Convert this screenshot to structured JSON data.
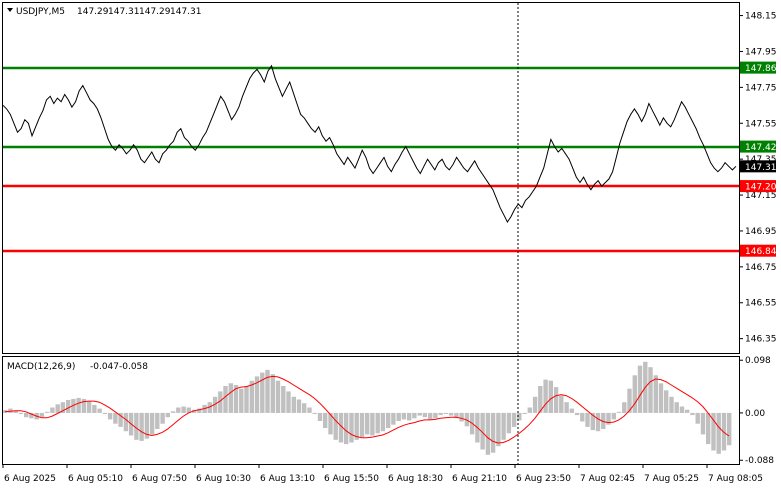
{
  "chart_data": [
    {
      "type": "line",
      "title": "USDJPY,M5",
      "ohlc": [
        "147.29",
        "147.31",
        "147.29",
        "147.31"
      ],
      "ylim": [
        146.27,
        148.22
      ],
      "yticks": [
        "148.15",
        "147.95",
        "147.75",
        "147.55",
        "147.35",
        "147.15",
        "146.95",
        "146.75",
        "146.55",
        "146.35"
      ],
      "ytick_values": [
        148.15,
        147.95,
        147.75,
        147.55,
        147.35,
        147.15,
        146.95,
        146.75,
        146.55,
        146.35
      ],
      "xticks": [
        "6 Aug 2025",
        "6 Aug 05:10",
        "6 Aug 07:50",
        "6 Aug 10:30",
        "6 Aug 13:10",
        "6 Aug 15:50",
        "6 Aug 18:30",
        "6 Aug 21:10",
        "6 Aug 23:50",
        "7 Aug 02:45",
        "7 Aug 05:25",
        "7 Aug 08:05"
      ],
      "current_price": 147.31,
      "current_label": "147.31",
      "levels": [
        {
          "label": "147.86",
          "value": 147.86,
          "color": "#008000"
        },
        {
          "label": "147.42",
          "value": 147.42,
          "color": "#008000"
        },
        {
          "label": "147.20",
          "value": 147.2,
          "color": "#ff0000"
        },
        {
          "label": "146.84",
          "value": 146.84,
          "color": "#ff0000"
        }
      ],
      "price": [
        147.65,
        147.63,
        147.6,
        147.55,
        147.5,
        147.52,
        147.57,
        147.55,
        147.48,
        147.53,
        147.58,
        147.62,
        147.68,
        147.7,
        147.66,
        147.69,
        147.67,
        147.71,
        147.68,
        147.64,
        147.67,
        147.73,
        147.76,
        147.72,
        147.68,
        147.66,
        147.63,
        147.58,
        147.52,
        147.46,
        147.42,
        147.4,
        147.43,
        147.41,
        147.38,
        147.4,
        147.43,
        147.4,
        147.35,
        147.33,
        147.36,
        147.39,
        147.35,
        147.33,
        147.38,
        147.4,
        147.43,
        147.45,
        147.5,
        147.52,
        147.47,
        147.45,
        147.42,
        147.4,
        147.43,
        147.47,
        147.5,
        147.55,
        147.6,
        147.65,
        147.7,
        147.67,
        147.62,
        147.57,
        147.6,
        147.64,
        147.7,
        147.75,
        147.8,
        147.83,
        147.85,
        147.82,
        147.78,
        147.84,
        147.87,
        147.8,
        147.75,
        147.7,
        147.74,
        147.78,
        147.72,
        147.66,
        147.6,
        147.58,
        147.55,
        147.52,
        147.5,
        147.53,
        147.48,
        147.45,
        147.47,
        147.43,
        147.38,
        147.35,
        147.32,
        147.36,
        147.33,
        147.3,
        147.35,
        147.4,
        147.36,
        147.3,
        147.27,
        147.3,
        147.33,
        147.36,
        147.31,
        147.28,
        147.32,
        147.35,
        147.39,
        147.42,
        147.38,
        147.34,
        147.3,
        147.27,
        147.31,
        147.35,
        147.32,
        147.29,
        147.33,
        147.35,
        147.31,
        147.29,
        147.32,
        147.36,
        147.33,
        147.3,
        147.28,
        147.31,
        147.34,
        147.3,
        147.27,
        147.24,
        147.21,
        147.18,
        147.13,
        147.08,
        147.04,
        147.0,
        147.03,
        147.07,
        147.1,
        147.08,
        147.12,
        147.14,
        147.17,
        147.2,
        147.25,
        147.3,
        147.38,
        147.46,
        147.42,
        147.39,
        147.41,
        147.38,
        147.35,
        147.3,
        147.25,
        147.22,
        147.25,
        147.21,
        147.18,
        147.21,
        147.23,
        147.2,
        147.22,
        147.24,
        147.28,
        147.36,
        147.44,
        147.5,
        147.56,
        147.6,
        147.63,
        147.6,
        147.56,
        147.6,
        147.66,
        147.62,
        147.58,
        147.54,
        147.58,
        147.55,
        147.53,
        147.57,
        147.62,
        147.67,
        147.64,
        147.6,
        147.56,
        147.52,
        147.47,
        147.43,
        147.38,
        147.33,
        147.3,
        147.28,
        147.3,
        147.33,
        147.31,
        147.29,
        147.31
      ]
    },
    {
      "type": "bar",
      "title": "MACD(12,26,9)",
      "values_label": [
        "-0.047",
        "-0.058"
      ],
      "ylim": [
        -0.095,
        0.104
      ],
      "yticks": [
        "0.098",
        "0.00",
        "-0.088"
      ],
      "ytick_values": [
        0.098,
        0.0,
        -0.088
      ],
      "histogram": [
        0.005,
        0.008,
        0.004,
        -0.002,
        -0.008,
        -0.01,
        -0.012,
        -0.008,
        0.002,
        0.01,
        0.016,
        0.02,
        0.024,
        0.026,
        0.028,
        0.026,
        0.022,
        0.015,
        0.008,
        -0.002,
        -0.012,
        -0.02,
        -0.026,
        -0.034,
        -0.042,
        -0.05,
        -0.052,
        -0.048,
        -0.04,
        -0.03,
        -0.02,
        -0.008,
        0.003,
        0.01,
        0.012,
        0.01,
        0.006,
        0.008,
        0.015,
        0.02,
        0.03,
        0.04,
        0.05,
        0.055,
        0.052,
        0.045,
        0.05,
        0.06,
        0.068,
        0.075,
        0.08,
        0.072,
        0.06,
        0.05,
        0.04,
        0.03,
        0.025,
        0.018,
        0.01,
        -0.002,
        -0.015,
        -0.028,
        -0.04,
        -0.05,
        -0.055,
        -0.058,
        -0.055,
        -0.05,
        -0.045,
        -0.04,
        -0.042,
        -0.038,
        -0.034,
        -0.028,
        -0.022,
        -0.015,
        -0.012,
        -0.014,
        -0.01,
        -0.005,
        -0.008,
        -0.012,
        -0.01,
        -0.004,
        -0.002,
        -0.005,
        -0.01,
        -0.016,
        -0.025,
        -0.04,
        -0.055,
        -0.068,
        -0.078,
        -0.074,
        -0.062,
        -0.05,
        -0.038,
        -0.026,
        -0.014,
        -0.002,
        0.01,
        0.03,
        0.05,
        0.062,
        0.06,
        0.048,
        0.032,
        0.02,
        0.008,
        -0.004,
        -0.016,
        -0.026,
        -0.032,
        -0.034,
        -0.03,
        -0.022,
        -0.012,
        0.002,
        0.02,
        0.045,
        0.07,
        0.088,
        0.095,
        0.085,
        0.07,
        0.055,
        0.042,
        0.03,
        0.02,
        0.012,
        0.006,
        -0.004,
        -0.02,
        -0.04,
        -0.058,
        -0.07,
        -0.076,
        -0.07,
        -0.06
      ],
      "signal": [
        0.002,
        0.003,
        0.004,
        0.004,
        0.002,
        -0.002,
        -0.006,
        -0.009,
        -0.009,
        -0.006,
        -0.001,
        0.004,
        0.009,
        0.014,
        0.018,
        0.021,
        0.022,
        0.022,
        0.02,
        0.015,
        0.009,
        0.002,
        -0.005,
        -0.012,
        -0.02,
        -0.028,
        -0.035,
        -0.04,
        -0.042,
        -0.04,
        -0.036,
        -0.03,
        -0.022,
        -0.014,
        -0.006,
        0.0,
        0.004,
        0.006,
        0.008,
        0.011,
        0.016,
        0.022,
        0.03,
        0.038,
        0.045,
        0.048,
        0.049,
        0.052,
        0.056,
        0.061,
        0.066,
        0.068,
        0.067,
        0.063,
        0.058,
        0.052,
        0.046,
        0.04,
        0.034,
        0.027,
        0.018,
        0.008,
        -0.003,
        -0.014,
        -0.024,
        -0.033,
        -0.04,
        -0.044,
        -0.046,
        -0.046,
        -0.045,
        -0.043,
        -0.041,
        -0.037,
        -0.032,
        -0.027,
        -0.023,
        -0.02,
        -0.018,
        -0.015,
        -0.013,
        -0.013,
        -0.012,
        -0.01,
        -0.009,
        -0.008,
        -0.008,
        -0.01,
        -0.013,
        -0.019,
        -0.027,
        -0.036,
        -0.046,
        -0.053,
        -0.056,
        -0.055,
        -0.051,
        -0.045,
        -0.038,
        -0.03,
        -0.021,
        -0.01,
        0.003,
        0.016,
        0.026,
        0.032,
        0.034,
        0.032,
        0.027,
        0.02,
        0.012,
        0.004,
        -0.004,
        -0.011,
        -0.016,
        -0.018,
        -0.017,
        -0.013,
        -0.006,
        0.004,
        0.017,
        0.032,
        0.047,
        0.058,
        0.063,
        0.062,
        0.058,
        0.052,
        0.046,
        0.04,
        0.034,
        0.028,
        0.021,
        0.012,
        0.0,
        -0.013,
        -0.026,
        -0.036,
        -0.043
      ]
    }
  ]
}
